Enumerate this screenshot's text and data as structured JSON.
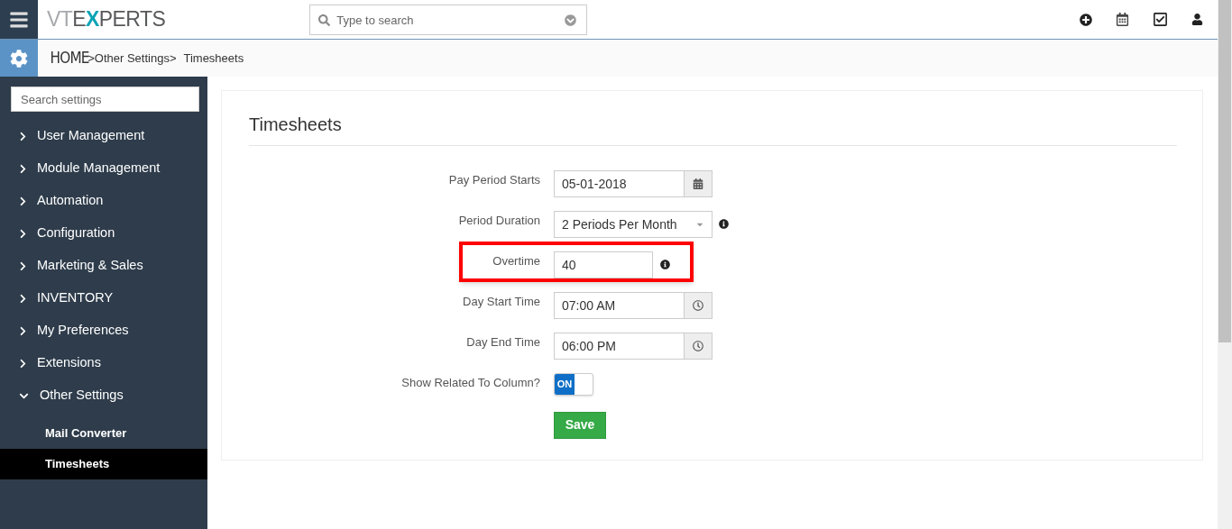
{
  "logo": [
    {
      "text": "VT",
      "color": "#a6a8ab"
    },
    {
      "text": "E",
      "color": "#58595b"
    },
    {
      "text": "X",
      "color": "#0aa3b5"
    },
    {
      "text": "PERTS",
      "color": "#58595b"
    }
  ],
  "search": {
    "placeholder": "Type to search"
  },
  "breadcrumb": [
    {
      "text": "HOME",
      "kind": "home"
    },
    {
      "text": ">Other Settings>",
      "kind": "link"
    },
    {
      "text": "Timesheets",
      "kind": "current"
    }
  ],
  "sidebar": {
    "search": {
      "placeholder": "Search settings"
    },
    "items": [
      {
        "label": "User Management",
        "expanded": false
      },
      {
        "label": "Module Management",
        "expanded": false
      },
      {
        "label": "Automation",
        "expanded": false
      },
      {
        "label": "Configuration",
        "expanded": false
      },
      {
        "label": "Marketing & Sales",
        "expanded": false
      },
      {
        "label": "INVENTORY",
        "expanded": false
      },
      {
        "label": "My Preferences",
        "expanded": false
      },
      {
        "label": "Extensions",
        "expanded": false
      },
      {
        "label": "Other Settings",
        "expanded": true,
        "children": [
          {
            "label": "Mail Converter",
            "selected": false
          },
          {
            "label": "Timesheets",
            "selected": true
          }
        ]
      }
    ]
  },
  "page": {
    "title": "Timesheets",
    "fields": [
      {
        "kind": "date",
        "label": "Pay Period Starts",
        "value": "05-01-2018",
        "info": false,
        "highlighted": false
      },
      {
        "kind": "select",
        "label": "Period Duration",
        "value": "2 Periods Per Month",
        "info": true,
        "highlighted": false
      },
      {
        "kind": "text",
        "label": "Overtime",
        "value": "40",
        "info": true,
        "highlighted": true
      },
      {
        "kind": "time",
        "label": "Day Start Time",
        "value": "07:00 AM",
        "info": false,
        "highlighted": false
      },
      {
        "kind": "time",
        "label": "Day End Time",
        "value": "06:00 PM",
        "info": false,
        "highlighted": false
      },
      {
        "kind": "toggle",
        "label": "Show Related To Column?",
        "value": "ON",
        "on": true,
        "info": false,
        "highlighted": false
      }
    ],
    "save": "Save"
  }
}
